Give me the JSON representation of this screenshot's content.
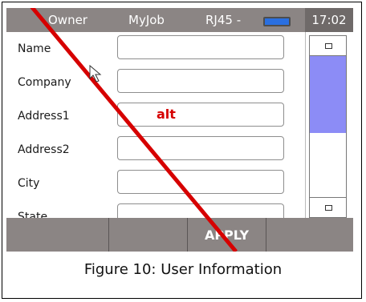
{
  "status_bar": {
    "owner": "Owner",
    "job": "MyJob",
    "port": "RJ45 -",
    "time": "17:02"
  },
  "form": {
    "fields": [
      {
        "label": "Name",
        "value": ""
      },
      {
        "label": "Company",
        "value": ""
      },
      {
        "label": "Address1",
        "value": "alt"
      },
      {
        "label": "Address2",
        "value": ""
      },
      {
        "label": "City",
        "value": ""
      },
      {
        "label": "State",
        "value": ""
      }
    ]
  },
  "softkeys": [
    "",
    "",
    "APPLY",
    ""
  ],
  "caption": "Figure 10: User Information",
  "colors": {
    "bar": "#8b8584",
    "scroll_thumb": "#8c8cf6",
    "battery": "#2a6fe0",
    "annotation": "#d60000"
  }
}
